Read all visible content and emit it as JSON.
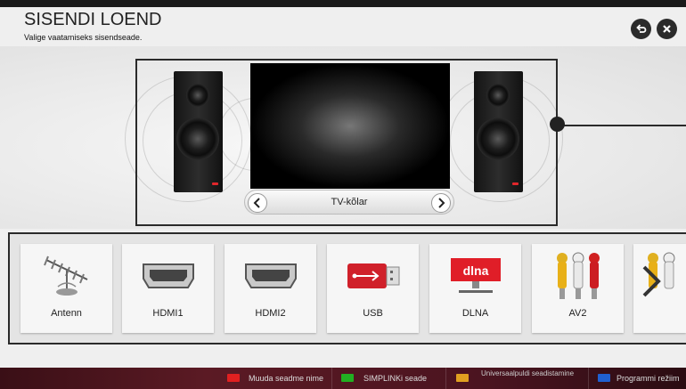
{
  "header": {
    "title": "SISENDI LOEND",
    "subtitle": "Valige vaatamiseks sisendseade."
  },
  "preview": {
    "selected_output": "TV-kõlar"
  },
  "inputs": [
    {
      "label": "Antenn",
      "icon": "antenna-icon"
    },
    {
      "label": "HDMI1",
      "icon": "hdmi-icon"
    },
    {
      "label": "HDMI2",
      "icon": "hdmi-icon"
    },
    {
      "label": "USB",
      "icon": "usb-icon"
    },
    {
      "label": "DLNA",
      "icon": "dlna-icon",
      "icon_text": "dlna"
    },
    {
      "label": "AV2",
      "icon": "rca-connectors-icon"
    },
    {
      "label": "",
      "icon": "rca-connectors-icon"
    }
  ],
  "bottom_bar": {
    "keys": [
      {
        "color": "#e02020",
        "label": "Muuda seadme nime"
      },
      {
        "color": "#22b022",
        "label": "SIMPLINKi seade"
      },
      {
        "color": "#e0a020",
        "label": "Universaalpuldi seadistamine"
      },
      {
        "color": "#2060d0",
        "label": "Programmi režiim"
      }
    ]
  },
  "colors": {
    "accent_red": "#e0262b",
    "bottom_bar": "#5b1a24"
  }
}
